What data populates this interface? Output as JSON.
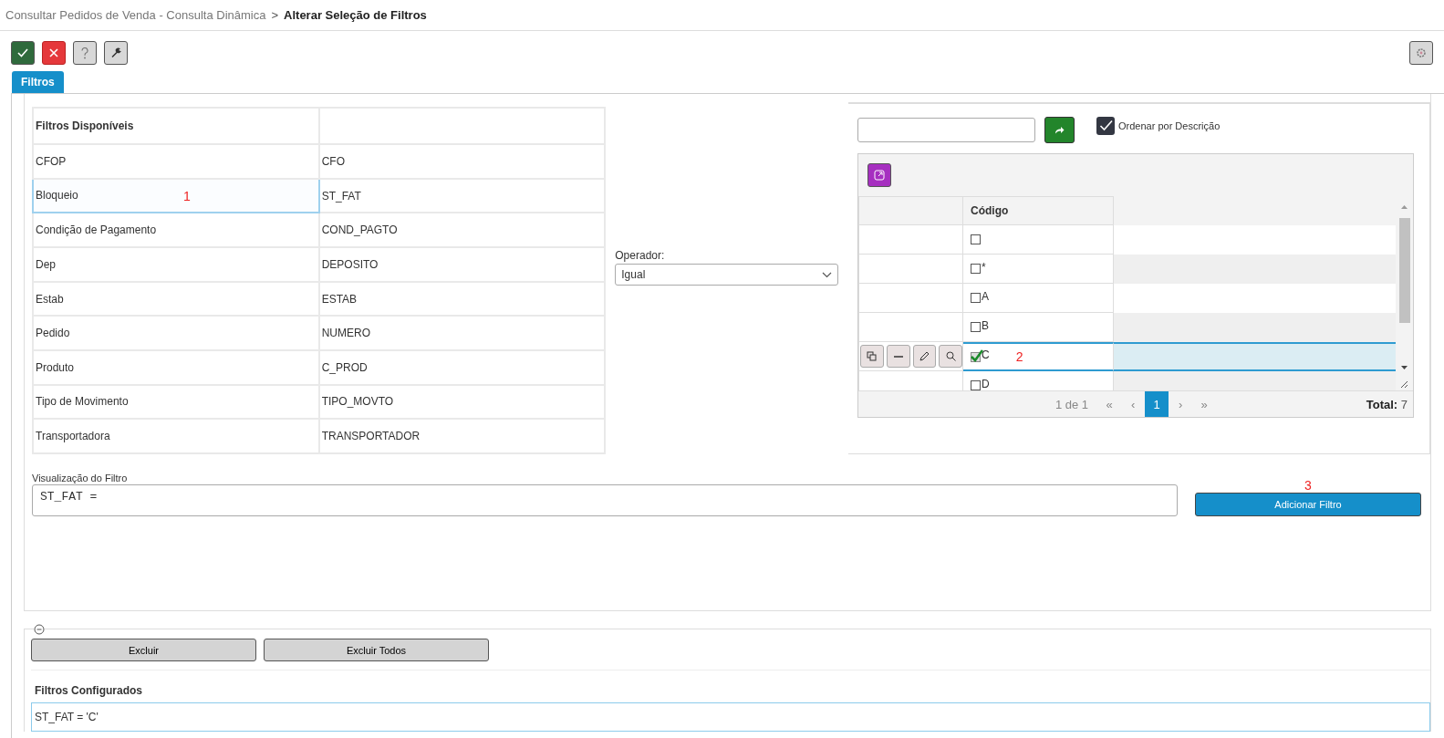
{
  "breadcrumb": {
    "parent": "Consultar Pedidos de Venda - Consulta Dinâmica",
    "separator": ">",
    "current": "Alterar Seleção de Filtros"
  },
  "toolbar": {
    "buttons": [
      {
        "kind": "confirm"
      },
      {
        "kind": "cancel"
      },
      {
        "kind": "help"
      },
      {
        "kind": "tools"
      }
    ]
  },
  "tabs": [
    {
      "label": "Filtros",
      "selected": true
    }
  ],
  "available_filters": {
    "heading": "Filtros Disponíveis",
    "rows": [
      {
        "description": "CFOP",
        "field": "CFO",
        "selected": false
      },
      {
        "description": "Bloqueio",
        "field": "ST_FAT",
        "selected": true,
        "annotation": "1"
      },
      {
        "description": "Condição de Pagamento",
        "field": "COND_PAGTO",
        "selected": false
      },
      {
        "description": "Dep",
        "field": "DEPOSITO",
        "selected": false
      },
      {
        "description": "Estab",
        "field": "ESTAB",
        "selected": false
      },
      {
        "description": "Pedido",
        "field": "NUMERO",
        "selected": false
      },
      {
        "description": "Produto",
        "field": "C_PROD",
        "selected": false
      },
      {
        "description": "Tipo de Movimento",
        "field": "TIPO_MOVTO",
        "selected": false
      },
      {
        "description": "Transportadora",
        "field": "TRANSPORTADOR",
        "selected": false
      }
    ]
  },
  "operator": {
    "label": "Operador:",
    "value": "Igual"
  },
  "value_picker": {
    "sort_by_description": {
      "label": "Ordenar por Descrição",
      "checked": true
    },
    "grid": {
      "columns": [
        "Código"
      ],
      "rows": [
        {
          "checked": false,
          "selected": false
        },
        {
          "code": "*",
          "checked": false,
          "selected": false
        },
        {
          "code": "A",
          "checked": false,
          "selected": false
        },
        {
          "code": "B",
          "checked": false,
          "selected": false
        },
        {
          "code": "C",
          "checked": true,
          "selected": true,
          "annotation": "2"
        },
        {
          "code": "D",
          "checked": false,
          "selected": false
        }
      ]
    },
    "pager": {
      "range": "1 de 1",
      "first": "«",
      "prev": "‹",
      "pages": [
        {
          "label": "1",
          "selected": true
        }
      ],
      "next": "›",
      "last": "»",
      "total_label": "Total:",
      "total": "7"
    }
  },
  "filter_preview": {
    "label": "Visualização do Filtro",
    "value": "ST_FAT ="
  },
  "add_button": {
    "label": "Adicionar Filtro",
    "annotation": "3"
  },
  "configured": {
    "buttons": [
      "Excluir",
      "Excluir Todos"
    ],
    "heading": "Filtros Configurados",
    "rows": [
      {
        "text": "ST_FAT = 'C'",
        "selected": true
      }
    ]
  }
}
